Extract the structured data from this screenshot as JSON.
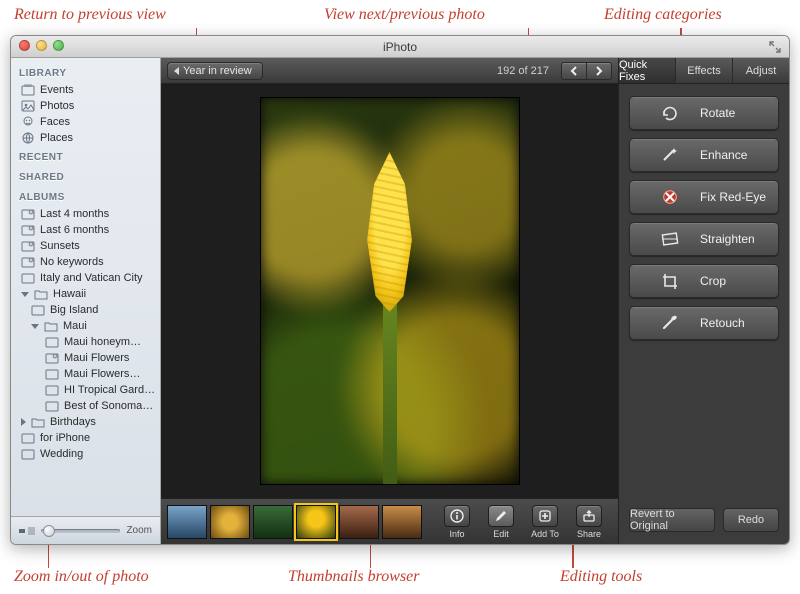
{
  "annotations": {
    "return_prev": "Return to previous view",
    "view_np": "View next/previous photo",
    "edit_cats": "Editing categories",
    "zoom_io": "Zoom in/out of photo",
    "thumbs": "Thumbnails browser",
    "edit_tools": "Editing tools"
  },
  "window": {
    "title": "iPhoto"
  },
  "sidebar": {
    "library_head": "LIBRARY",
    "library": [
      "Events",
      "Photos",
      "Faces",
      "Places"
    ],
    "recent_head": "RECENT",
    "shared_head": "SHARED",
    "albums_head": "ALBUMS",
    "albums": [
      "Last 4 months",
      "Last 6 months",
      "Sunsets",
      "No keywords",
      "Italy and Vatican City"
    ],
    "hawaii": "Hawaii",
    "hawaii_sub": [
      "Big Island"
    ],
    "maui": "Maui",
    "maui_sub": [
      "Maui honeym…",
      "Maui Flowers",
      "Maui Flowers…",
      "HI Tropical Gard…",
      "Best of Sonoma…"
    ],
    "tail": [
      "Birthdays",
      "for iPhone",
      "Wedding"
    ],
    "zoom_label": "Zoom"
  },
  "toolbar": {
    "crumb": "Year in review",
    "counter": "192 of 217"
  },
  "tabs": {
    "a": "Quick Fixes",
    "b": "Effects",
    "c": "Adjust"
  },
  "tools": {
    "rotate": "Rotate",
    "enhance": "Enhance",
    "redeye": "Fix Red-Eye",
    "straighten": "Straighten",
    "crop": "Crop",
    "retouch": "Retouch"
  },
  "footer": {
    "revert": "Revert to Original",
    "redo": "Redo"
  },
  "bottom": {
    "info": "Info",
    "edit": "Edit",
    "addto": "Add To",
    "share": "Share"
  }
}
